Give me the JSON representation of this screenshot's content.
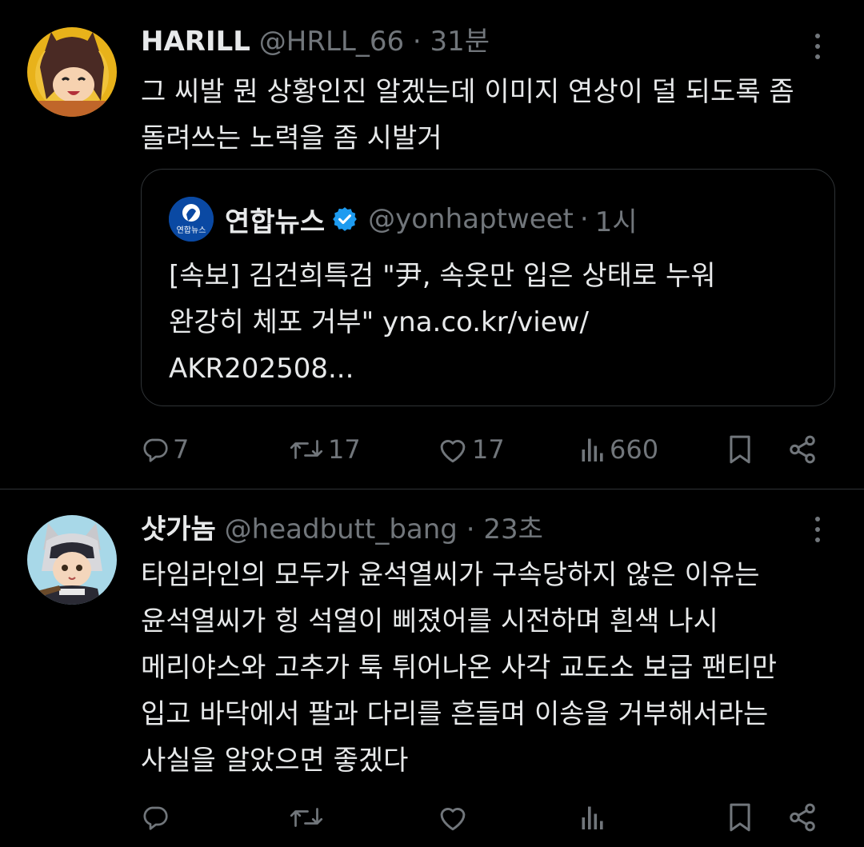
{
  "tweets": [
    {
      "display_name": "HARILL",
      "handle": "@HRLL_66",
      "separator": "·",
      "time": "31분",
      "text_lines": [
        "그 씨발 뭔 상황인진 알겠는데 이미지 연상이 덜 되도록 좀",
        "돌려쓰는 노력을 좀 시발거"
      ],
      "quote": {
        "logo_text": "연합뉴스",
        "display_name": "연합뉴스",
        "handle": "@yonhaptweet",
        "separator": "·",
        "time": "1시",
        "text_lines": [
          "[속보] 김건희특검 \"尹, 속옷만 입은 상태로 누워",
          "완강히 체포 거부\" yna.co.kr/view/",
          "AKR202508..."
        ]
      },
      "actions": {
        "replies": "7",
        "retweets": "17",
        "likes": "17",
        "views": "660"
      }
    },
    {
      "display_name": "샷가놈",
      "handle": "@headbutt_bang",
      "separator": "·",
      "time": "23초",
      "text_lines": [
        "타임라인의 모두가 윤석열씨가 구속당하지 않은 이유는",
        "윤석열씨가 힝 석열이 삐졌어를 시전하며 흰색 나시",
        "메리야스와 고추가 툭 튀어나온 사각 교도소 보급 팬티만",
        "입고 바닥에서 팔과 다리를 흔들며 이송을 거부해서라는",
        "사실을 알았으면 좋겠다"
      ],
      "actions": {
        "replies": "",
        "retweets": "",
        "likes": "",
        "views": ""
      }
    }
  ],
  "colors": {
    "background": "#000000",
    "text": "#e7e9ea",
    "muted": "#71767b",
    "border": "#2f3336",
    "verified": "#1d9bf0"
  },
  "icons": [
    "more-icon",
    "reply-icon",
    "retweet-icon",
    "like-icon",
    "views-icon",
    "bookmark-icon",
    "share-icon",
    "verified-icon"
  ]
}
